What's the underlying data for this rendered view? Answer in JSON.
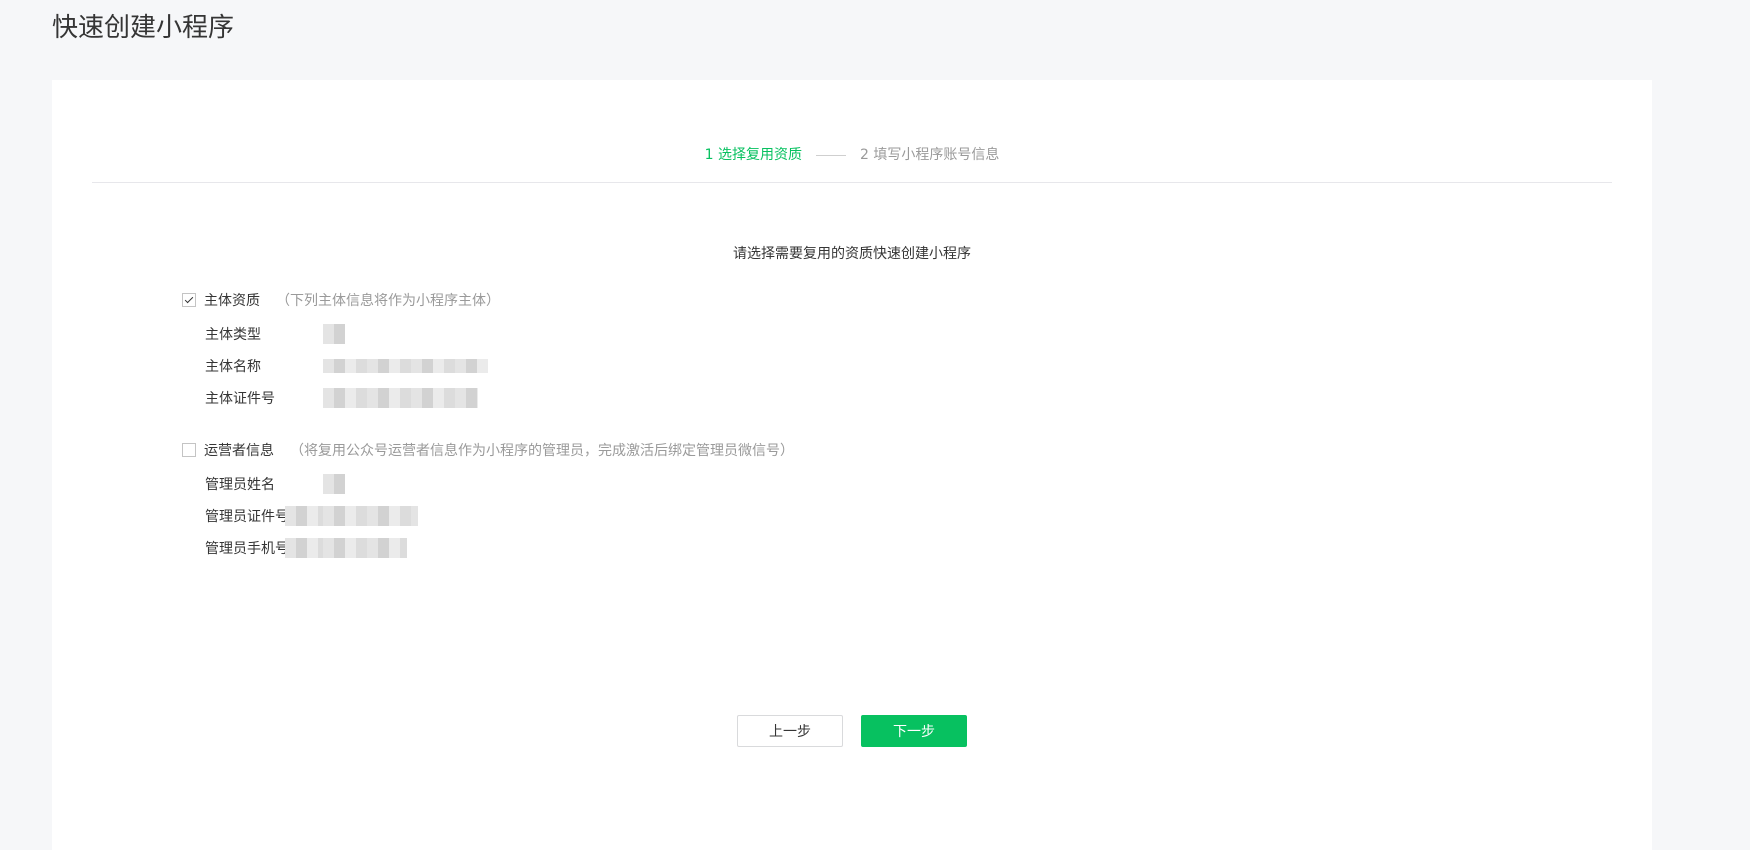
{
  "page": {
    "title": "快速创建小程序"
  },
  "steps": [
    {
      "label": "1 选择复用资质",
      "state": "active"
    },
    {
      "label": "2 填写小程序账号信息",
      "state": "inactive"
    }
  ],
  "prompt": "请选择需要复用的资质快速创建小程序",
  "sections": {
    "entity": {
      "checked": true,
      "title": "主体资质",
      "hint": "（下列主体信息将作为小程序主体）",
      "fields": [
        {
          "label": "主体类型"
        },
        {
          "label": "主体名称"
        },
        {
          "label": "主体证件号"
        }
      ]
    },
    "operator": {
      "checked": false,
      "title": "运营者信息",
      "hint": "（将复用公众号运营者信息作为小程序的管理员，完成激活后绑定管理员微信号）",
      "fields": [
        {
          "label": "管理员姓名"
        },
        {
          "label": "管理员证件号"
        },
        {
          "label": "管理员手机号"
        }
      ]
    }
  },
  "buttons": {
    "prev": "上一步",
    "next": "下一步"
  },
  "colors": {
    "accent": "#07c160",
    "text": "#353535",
    "muted": "#9a9a9a",
    "background": "#f6f7f9"
  }
}
